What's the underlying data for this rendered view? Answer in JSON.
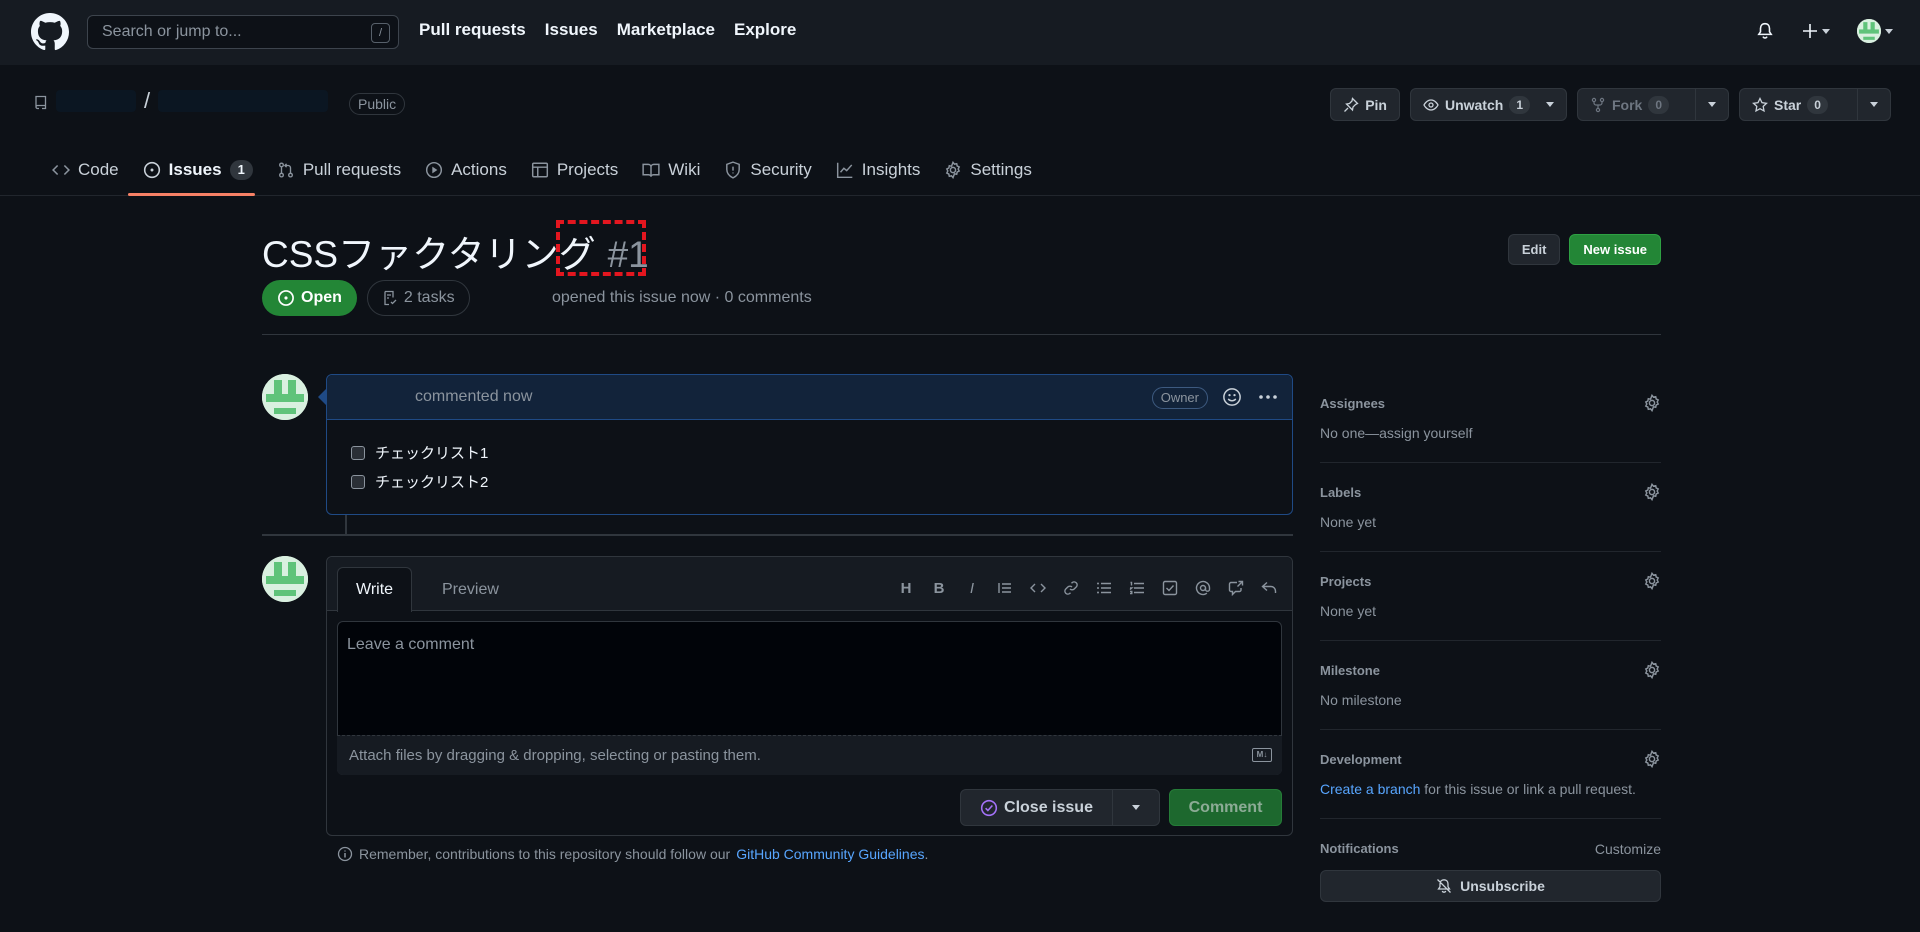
{
  "header": {
    "search_placeholder": "Search or jump to...",
    "search_shortcut": "/",
    "nav": [
      "Pull requests",
      "Issues",
      "Marketplace",
      "Explore"
    ]
  },
  "repo": {
    "separator": "/",
    "visibility": "Public",
    "pin_label": "Pin",
    "unwatch_label": "Unwatch",
    "unwatch_count": "1",
    "fork_label": "Fork",
    "fork_count": "0",
    "star_label": "Star",
    "star_count": "0",
    "tabs": [
      {
        "label": "Code"
      },
      {
        "label": "Issues",
        "count": "1"
      },
      {
        "label": "Pull requests"
      },
      {
        "label": "Actions"
      },
      {
        "label": "Projects"
      },
      {
        "label": "Wiki"
      },
      {
        "label": "Security"
      },
      {
        "label": "Insights"
      },
      {
        "label": "Settings"
      }
    ]
  },
  "issue": {
    "title": "CSSファクタリング",
    "number": "#1",
    "edit_label": "Edit",
    "new_issue_label": "New issue",
    "state": "Open",
    "tasks": "2 tasks",
    "meta": "opened this issue now · 0 comments"
  },
  "comment": {
    "header": "commented now",
    "role": "Owner",
    "items": [
      "チェックリスト1",
      "チェックリスト2"
    ]
  },
  "editor": {
    "tab_write": "Write",
    "tab_preview": "Preview",
    "placeholder": "Leave a comment",
    "attach_hint": "Attach files by dragging & dropping, selecting or pasting them.",
    "close_label": "Close issue",
    "comment_label": "Comment",
    "guidelines_prefix": "Remember, contributions to this repository should follow our",
    "guidelines_link": "GitHub Community Guidelines",
    "guidelines_suffix": "."
  },
  "sidebar": {
    "assignees_title": "Assignees",
    "assignees_value": "No one—assign yourself",
    "labels_title": "Labels",
    "labels_value": "None yet",
    "projects_title": "Projects",
    "projects_value": "None yet",
    "milestone_title": "Milestone",
    "milestone_value": "No milestone",
    "development_title": "Development",
    "development_link": "Create a branch",
    "development_rest": " for this issue or link a pull request.",
    "notifications_title": "Notifications",
    "customize_label": "Customize",
    "unsubscribe_label": "Unsubscribe"
  },
  "colors": {
    "background": "#0d1117",
    "header": "#161b22",
    "accent_green": "#238636",
    "link": "#58a6ff",
    "tab_underline": "#f78166",
    "annotation": "#e3161f"
  }
}
